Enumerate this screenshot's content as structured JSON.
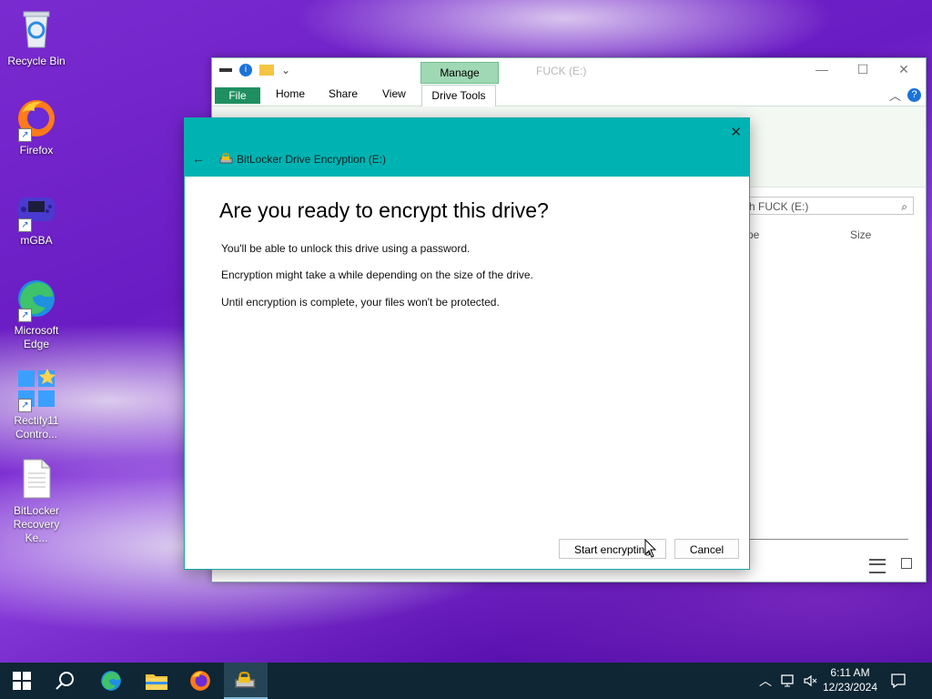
{
  "desktop": {
    "icons": [
      {
        "label": "Recycle Bin",
        "icon": "recycle-bin-icon"
      },
      {
        "label": "Firefox",
        "icon": "firefox-icon"
      },
      {
        "label": "mGBA",
        "icon": "mgba-icon"
      },
      {
        "label": "Microsoft Edge",
        "icon": "edge-icon"
      },
      {
        "label": "Rectify11 Contro...",
        "icon": "rectify11-icon"
      },
      {
        "label": "BitLocker Recovery Ke...",
        "icon": "text-document-icon"
      }
    ]
  },
  "explorer": {
    "manage_tab": "Manage",
    "title": "FUCK (E:)",
    "tabs": {
      "file": "File",
      "home": "Home",
      "share": "Share",
      "view": "View",
      "drive_tools": "Drive Tools"
    },
    "search_placeholder": "Search FUCK (E:)",
    "search_visible": "h FUCK (E:)",
    "columns": {
      "type": "pe",
      "size": "Size"
    }
  },
  "dialog": {
    "app_title": "BitLocker Drive Encryption (E:)",
    "heading": "Are you ready to encrypt this drive?",
    "lines": [
      "You'll be able to unlock this drive using a password.",
      "Encryption might take a while depending on the size of the drive.",
      "Until encryption is complete, your files won't be protected."
    ],
    "buttons": {
      "start": "Start encrypting",
      "cancel": "Cancel"
    }
  },
  "taskbar": {
    "items": [
      "start",
      "search",
      "edge",
      "file-explorer",
      "firefox",
      "bitlocker"
    ],
    "active": "bitlocker",
    "clock": {
      "time": "6:11 AM",
      "date": "12/23/2024"
    }
  },
  "colors": {
    "dialog_header": "#00b3b3",
    "file_tab": "#1f8f60",
    "manage_tab": "#9fd8b4",
    "taskbar": "#0f2634"
  }
}
